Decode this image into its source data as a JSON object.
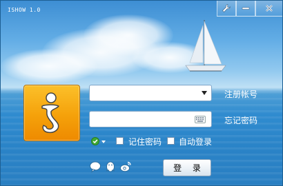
{
  "window": {
    "title": "ISHOW 1.0"
  },
  "title_bar": {
    "buttons": [
      {
        "name": "settings",
        "icon": "wrench-icon"
      },
      {
        "name": "minimize",
        "icon": "minimize-icon"
      },
      {
        "name": "close",
        "icon": "close-icon"
      }
    ]
  },
  "login": {
    "account_value": "",
    "password_value": "",
    "register_link": "注册帐号",
    "forgot_link": "忘记密码",
    "remember_label": "记住密码",
    "auto_login_label": "自动登录",
    "remember_checked": false,
    "auto_login_checked": false,
    "submit_label": "登 录"
  },
  "bottom_icons": [
    "chat-bubble-icon",
    "qq-penguin-icon",
    "weibo-icon"
  ],
  "colors": {
    "logo_bg": "#f5a10a",
    "sky": "#3d8ed3",
    "sea": "#2a83c7",
    "status_green": "#3fa935"
  }
}
